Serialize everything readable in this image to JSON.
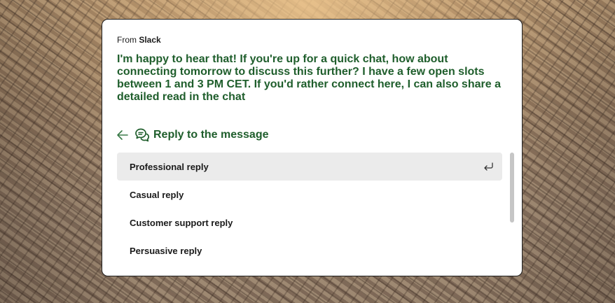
{
  "header": {
    "from_prefix": "From",
    "from_source": "Slack"
  },
  "message": {
    "text": "I'm happy to hear that! If you're up for a quick chat, how about connecting tomorrow to discuss this further? I have a few open slots between 1 and 3 PM CET. If you'd rather connect here, I can also share a detailed read in the chat"
  },
  "reply": {
    "title": "Reply to the message",
    "options": [
      {
        "label": "Professional reply",
        "selected": true
      },
      {
        "label": "Casual reply",
        "selected": false
      },
      {
        "label": "Customer support reply",
        "selected": false
      },
      {
        "label": "Persuasive reply",
        "selected": false
      }
    ]
  },
  "icons": {
    "back": "arrow-left-icon",
    "chat": "chat-bubbles-icon",
    "enter": "return-key-icon"
  },
  "colors": {
    "accent_green": "#1f5e2c",
    "selected_bg": "#ebebeb"
  }
}
